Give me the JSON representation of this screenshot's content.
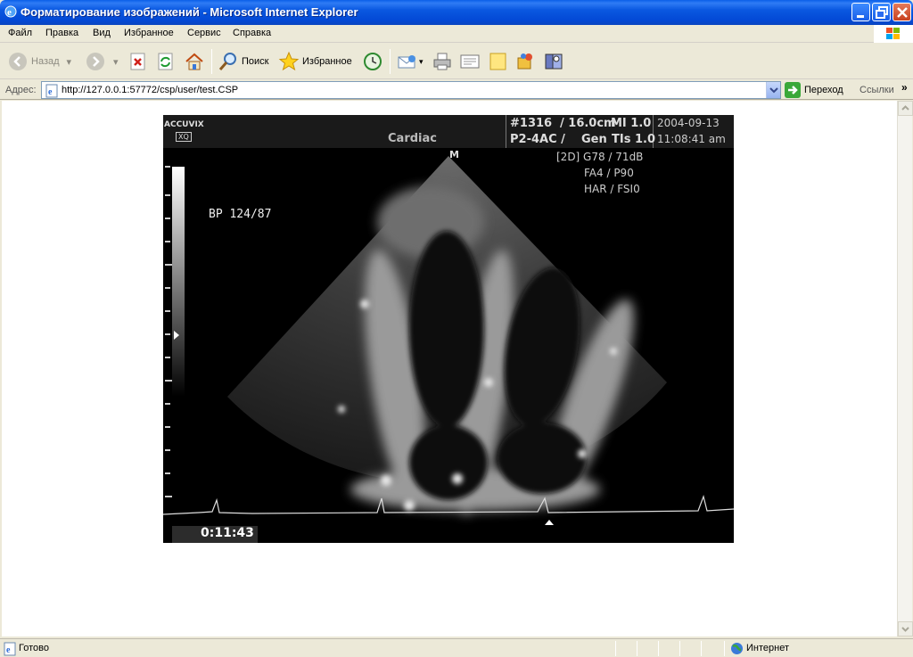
{
  "window": {
    "title": "Форматирование изображений - Microsoft Internet Explorer"
  },
  "menu": {
    "items": [
      "Файл",
      "Правка",
      "Вид",
      "Избранное",
      "Сервис",
      "Справка"
    ]
  },
  "toolbar": {
    "back_label": "Назад",
    "search_label": "Поиск",
    "favorites_label": "Избранное"
  },
  "address": {
    "label": "Адрес:",
    "url": "http://127.0.0.1:57772/csp/user/test.CSP",
    "go_label": "Переход",
    "links_label": "Ссылки",
    "links_chevron": "»"
  },
  "ultrasound": {
    "brand": "ACCUVIX",
    "brand_sub": "XQ",
    "exam": "Cardiac",
    "image_no": "#1316",
    "depth": "/ 16.0cm",
    "mi": "MI  1.0",
    "view": "P2-4AC /",
    "preset": "Gen",
    "tis": "TIs 1.0",
    "date": "2004-09-13",
    "time": "11:08:41 am",
    "marker": "M",
    "mode_line": "[2D]  G78 / 71dB",
    "fa_line": "FA4 / P90",
    "har_line": "HAR / FSI0",
    "bp": "BP  124/87",
    "timer": "0:11:43"
  },
  "status": {
    "ready": "Готово",
    "zone": "Интернет"
  },
  "colors": {
    "titlebar": "#0a58e0",
    "chrome": "#ece9d8"
  }
}
